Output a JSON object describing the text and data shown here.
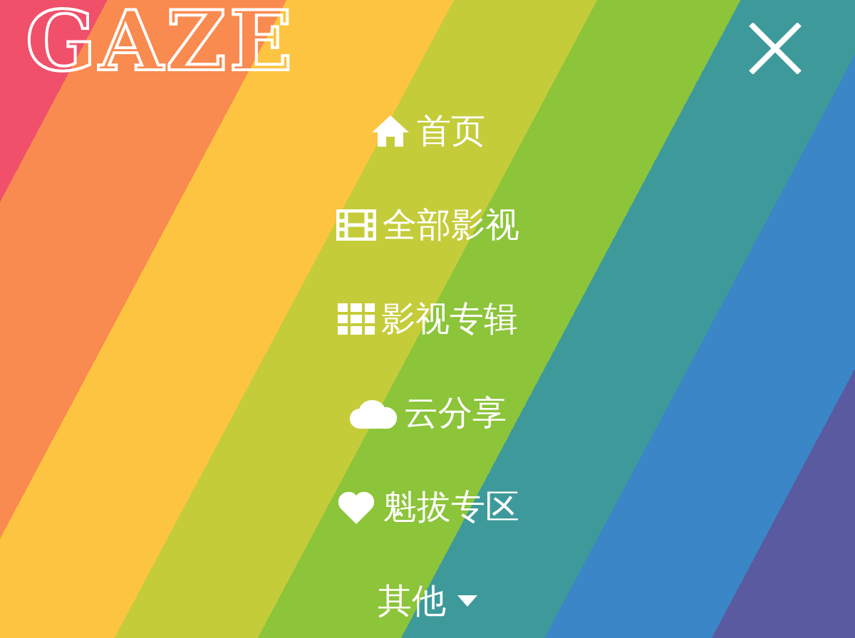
{
  "logo": "GAZE",
  "menu": [
    {
      "label": "首页",
      "kind": "link"
    },
    {
      "label": "全部影视",
      "kind": "link"
    },
    {
      "label": "影视专辑",
      "kind": "link"
    },
    {
      "label": "云分享",
      "kind": "link"
    },
    {
      "label": "魁拔专区",
      "kind": "link"
    },
    {
      "label": "其他",
      "kind": "dropdown"
    }
  ]
}
